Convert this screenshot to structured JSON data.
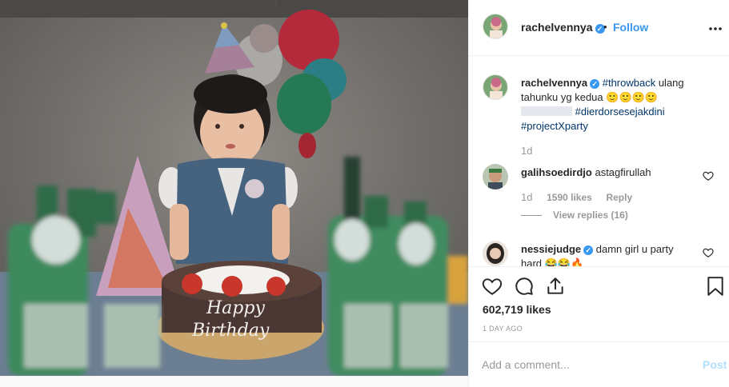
{
  "post": {
    "username": "rachelvennya",
    "verified_mark": "✓",
    "separator": "•",
    "follow_label": "Follow",
    "more_icon": "more-horizontal-icon"
  },
  "caption": {
    "username": "rachelvennya",
    "tag1": "#throwback",
    "text1": " ulang tahunku yg kedua",
    "emojis": "🙂🙂🙂🙂",
    "tag2": "#dierdorsesejakdini",
    "tag3": "#projectXparty",
    "time": "1d"
  },
  "comments": [
    {
      "username": "galihsoedirdjo",
      "text": "astagfirullah",
      "time": "1d",
      "likes": "1590 likes",
      "reply": "Reply",
      "view_replies": "View replies (16)"
    },
    {
      "username": "nessiejudge",
      "text": "damn girl u party hard",
      "emojis": "😂😂🔥"
    }
  ],
  "actions": {
    "likes": "602,719 likes",
    "time_ago": "1 DAY AGO"
  },
  "add_comment": {
    "placeholder": "Add a comment...",
    "post_label": "Post"
  },
  "photo": {
    "cake_text_1": "Happy",
    "cake_text_2": "Birthday"
  },
  "colors": {
    "link": "#3897f0",
    "hashtag": "#003569",
    "post_disabled": "#b2dffc"
  }
}
